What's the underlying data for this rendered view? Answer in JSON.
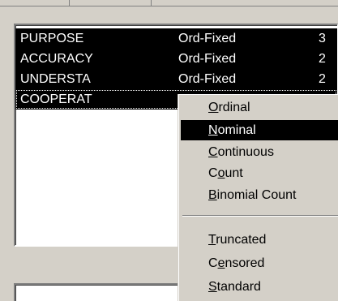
{
  "variables": {
    "rows": [
      {
        "name": "PURPOSE",
        "type": "Ord-Fixed",
        "num": "3"
      },
      {
        "name": "ACCURACY",
        "type": "Ord-Fixed",
        "num": "2"
      },
      {
        "name": "UNDERSTA",
        "type": "Ord-Fixed",
        "num": "2"
      },
      {
        "name": "COOPERAT",
        "type": "",
        "num": ""
      }
    ]
  },
  "menu": {
    "items": [
      {
        "pre": "",
        "key": "O",
        "post": "rdinal"
      },
      {
        "pre": "",
        "key": "N",
        "post": "ominal"
      },
      {
        "pre": "",
        "key": "C",
        "post": "ontinuous"
      },
      {
        "pre": "C",
        "key": "o",
        "post": "unt"
      },
      {
        "pre": "",
        "key": "B",
        "post": "inomial Count"
      },
      {
        "pre": "",
        "key": "T",
        "post": "runcated"
      },
      {
        "pre": "C",
        "key": "e",
        "post": "nsored"
      },
      {
        "pre": "",
        "key": "S",
        "post": "tandard"
      }
    ]
  },
  "colors": {
    "face": "#d4d0c8",
    "selection": "#000000",
    "selection_text": "#ffffff"
  }
}
